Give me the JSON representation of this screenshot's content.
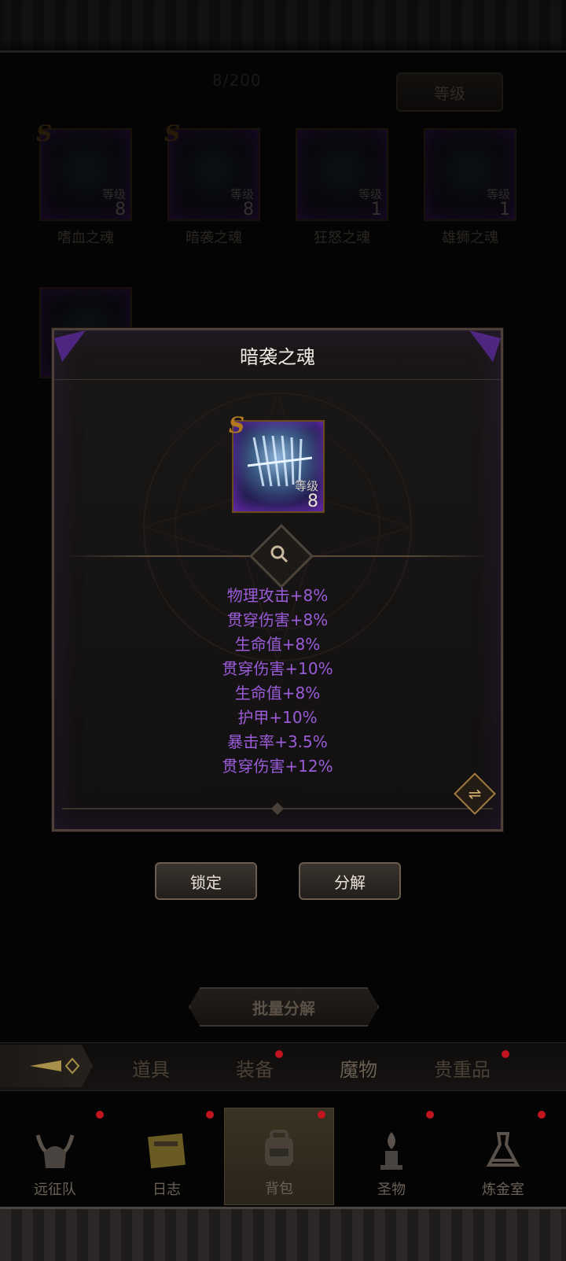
{
  "inventory": {
    "count": "8/200",
    "sort_label": "等级"
  },
  "slots": [
    {
      "name": "嗜血之魂",
      "rank": "S",
      "level_label": "等级",
      "level": "8"
    },
    {
      "name": "暗袭之魂",
      "rank": "S",
      "level_label": "等级",
      "level": "8"
    },
    {
      "name": "狂怒之魂",
      "rank": "",
      "level_label": "等级",
      "level": "1"
    },
    {
      "name": "雄狮之魂",
      "rank": "",
      "level_label": "等级",
      "level": "1"
    }
  ],
  "dialog": {
    "title": "暗袭之魂",
    "item": {
      "rank": "S",
      "level_label": "等级",
      "level": "8"
    },
    "attributes": [
      "物理攻击+8%",
      "贯穿伤害+8%",
      "生命值+8%",
      "贯穿伤害+10%",
      "生命值+8%",
      "护甲+10%",
      "暴击率+3.5%",
      "贯穿伤害+12%"
    ],
    "lock_label": "锁定",
    "decompose_label": "分解"
  },
  "batch_label": "批量分解",
  "tabs": [
    {
      "label": "道具",
      "badge": false
    },
    {
      "label": "装备",
      "badge": true
    },
    {
      "label": "魔物",
      "badge": false
    },
    {
      "label": "贵重品",
      "badge": true
    }
  ],
  "nav": [
    {
      "label": "远征队",
      "icon": "helmet-icon"
    },
    {
      "label": "日志",
      "icon": "journal-icon"
    },
    {
      "label": "背包",
      "icon": "backpack-icon"
    },
    {
      "label": "圣物",
      "icon": "relic-icon"
    },
    {
      "label": "炼金室",
      "icon": "alchemy-icon"
    }
  ],
  "colors": {
    "attribute": "#9a5cd8",
    "rank": "#b07820",
    "badge": "#c0141e"
  }
}
